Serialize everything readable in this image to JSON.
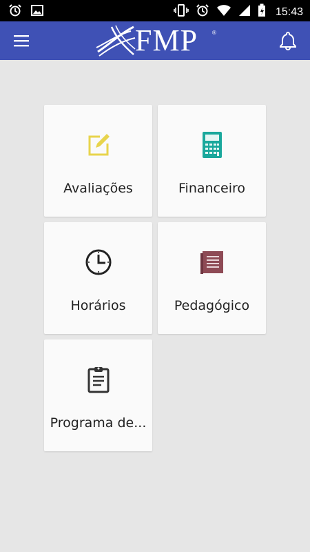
{
  "status_bar": {
    "time": "15:43",
    "icons": [
      "alarm-icon",
      "image-icon",
      "vibrate-icon",
      "alarm-icon",
      "wifi-icon",
      "signal-icon",
      "battery-icon"
    ]
  },
  "app_bar": {
    "brand": "FMP",
    "brand_mark": "®",
    "color": "#3f51b5",
    "menu_icon": "hamburger-icon",
    "notification_icon": "bell-icon"
  },
  "menu": {
    "items": [
      {
        "label": "Avaliações",
        "icon": "edit-icon",
        "color": "#e8d44d"
      },
      {
        "label": "Financeiro",
        "icon": "calculator-icon",
        "color": "#1aa89c"
      },
      {
        "label": "Horários",
        "icon": "clock-icon",
        "color": "#222222"
      },
      {
        "label": "Pedagógico",
        "icon": "book-icon",
        "color": "#8e4a55"
      },
      {
        "label": "Programa de...",
        "icon": "clipboard-icon",
        "color": "#333333"
      }
    ]
  }
}
